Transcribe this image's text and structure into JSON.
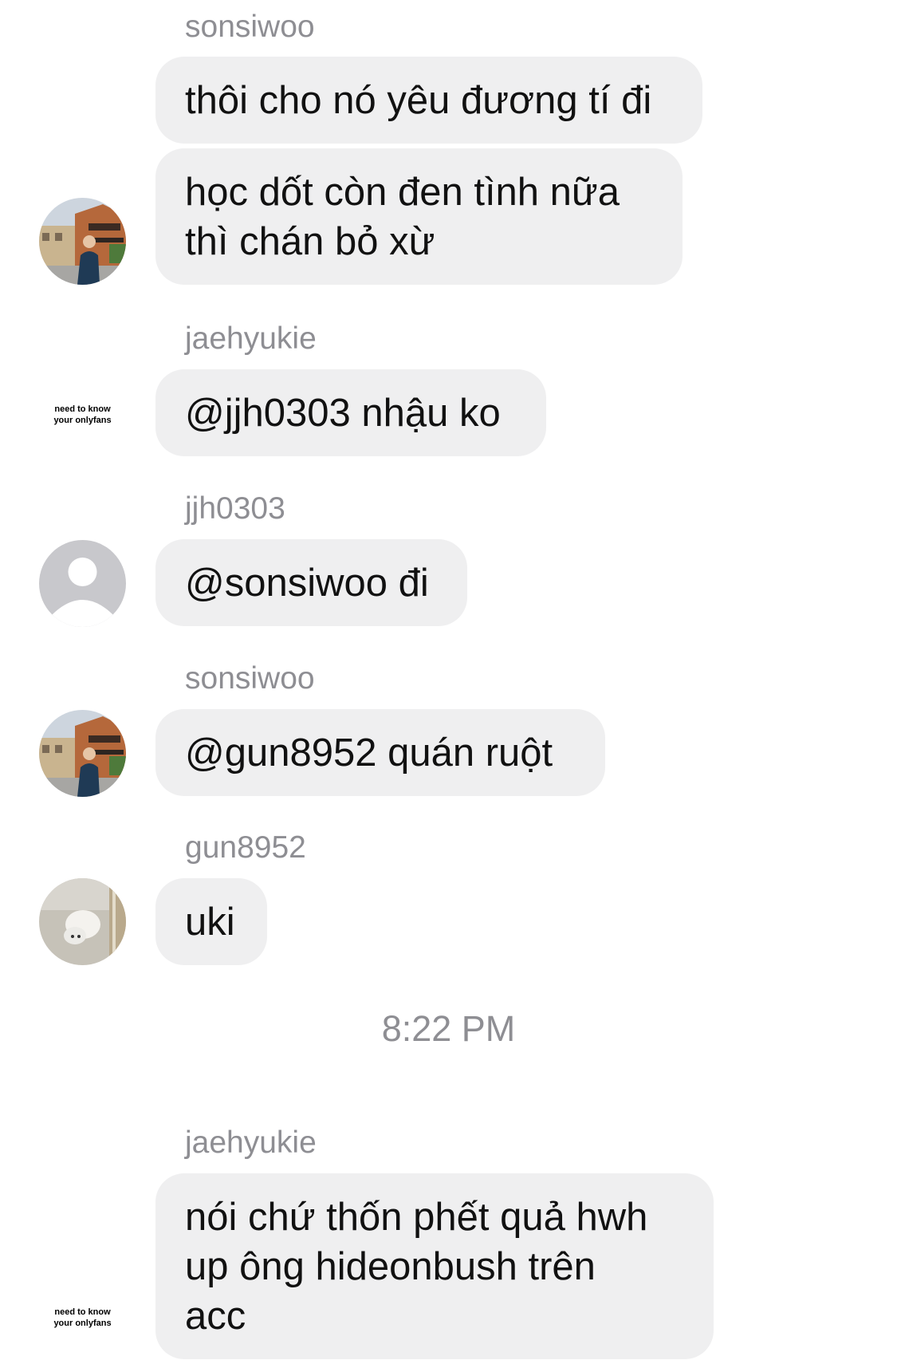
{
  "messages": [
    {
      "sender": "sonsiwoo",
      "bubbles": [
        "thôi cho nó yêu đương tí đi",
        "học dốt còn đen tình nữa\nthì chán bỏ xừ"
      ],
      "avatar": "street-photo-avatar"
    },
    {
      "sender": "jaehyukie",
      "bubbles": [
        "@jjh0303 nhậu ko"
      ],
      "avatar_text": "need to know\nyour onlyfans"
    },
    {
      "sender": "jjh0303",
      "bubbles": [
        "@sonsiwoo đi"
      ],
      "avatar": "default-user-avatar"
    },
    {
      "sender": "sonsiwoo",
      "bubbles": [
        "@gun8952 quán ruột"
      ],
      "avatar": "street-photo-avatar"
    },
    {
      "sender": "gun8952",
      "bubbles": [
        "uki"
      ],
      "avatar": "dog-photo-avatar"
    }
  ],
  "timestamp": "8:22 PM",
  "messages_after": [
    {
      "sender": "jaehyukie",
      "bubbles": [
        "nói chứ thốn phết quả hwh\nup ông hideonbush trên\nacc"
      ],
      "avatar_text": "need to know\nyour onlyfans"
    }
  ],
  "colors": {
    "bubble": "#efeff0",
    "meta_text": "#8e8e93",
    "text": "#111111"
  }
}
